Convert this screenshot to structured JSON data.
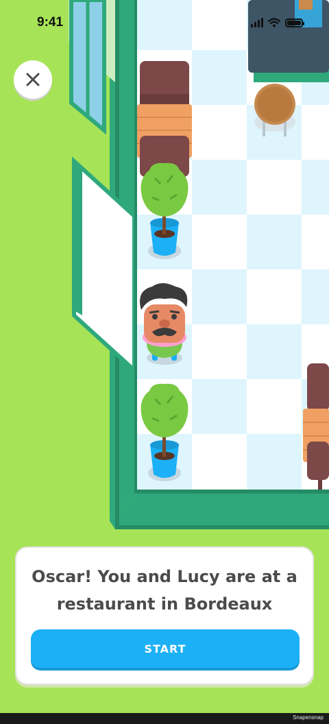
{
  "status_bar": {
    "time": "9:41"
  },
  "close_button": {
    "icon": "close-icon"
  },
  "intro_card": {
    "line1": "Oscar! You and Lucy are at a",
    "line2": "restaurant in Bordeaux",
    "start_label": "START"
  },
  "watermark": "Snapensnap",
  "colors": {
    "grass": "#a6e356",
    "wall": "#2fa97c",
    "floor_tile": "#def5fd",
    "button_blue": "#1cb0f6",
    "text_dark": "#4b4b4b"
  }
}
